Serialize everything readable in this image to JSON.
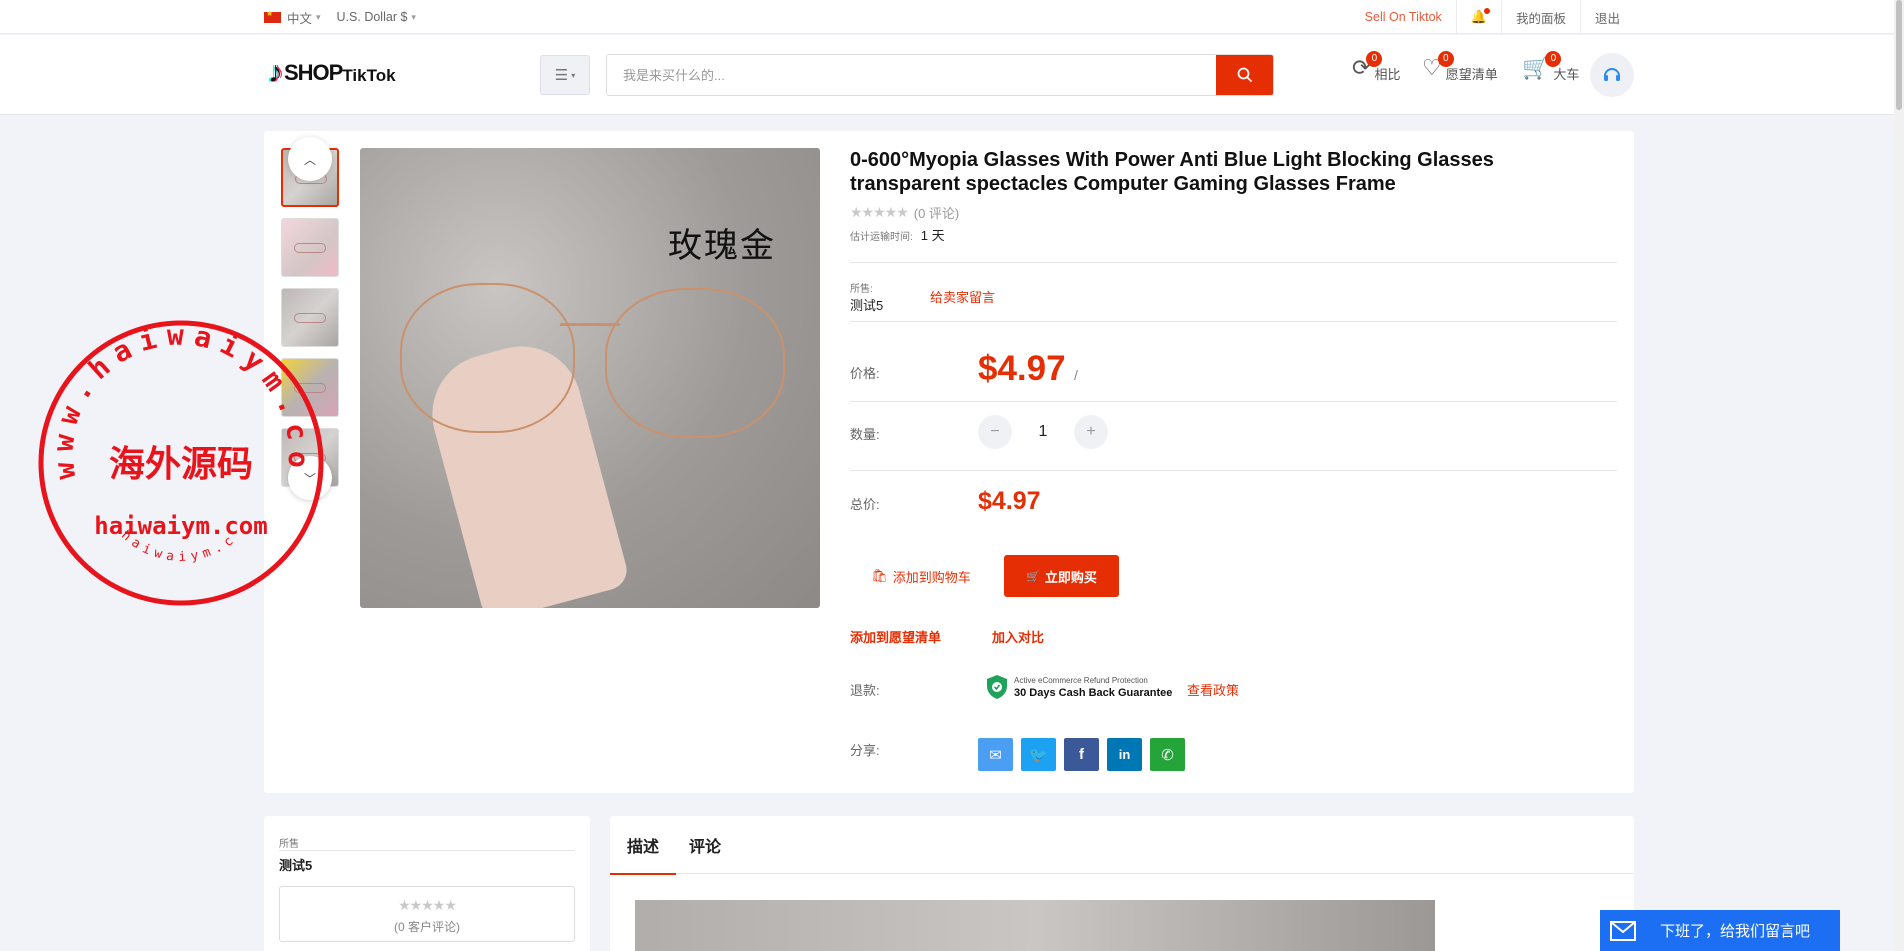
{
  "topbar": {
    "language": "中文",
    "currency": "U.S. Dollar $",
    "sell_link": "Sell On Tiktok",
    "dashboard": "我的面板",
    "logout": "退出"
  },
  "header": {
    "logo_shop": "SHOP",
    "logo_tiktok": "TikTok",
    "search_placeholder": "我是来买什么的...",
    "compare": {
      "label": "相比",
      "count": "0"
    },
    "wishlist": {
      "label": "愿望清单",
      "count": "0"
    },
    "cart": {
      "label": "大车",
      "count": "0"
    }
  },
  "product": {
    "title": "0-600°Myopia Glasses With Power Anti Blue Light Blocking Glasses transparent spectacles Computer Gaming Glasses Frame",
    "review_count": "(0 评论)",
    "rating": 0,
    "eta_label": "估计运输时间:",
    "eta_value": "1 天",
    "sold_by_label": "所售:",
    "seller_name": "测试5",
    "message_seller": "给卖家留言",
    "price_label": "价格:",
    "price": "$4.97",
    "price_unit": "/",
    "quantity_label": "数量:",
    "quantity": "1",
    "total_label": "总价:",
    "total": "$4.97",
    "add_to_cart": "添加到购物车",
    "buy_now": "立即购买",
    "add_wishlist": "添加到愿望清单",
    "add_compare": "加入对比",
    "refund_label": "退款:",
    "refund_small": "Active eCommerce Refund Protection",
    "refund_big": "30 Days Cash Back Guarantee",
    "view_policy": "查看政策",
    "share_label": "分享:",
    "image_text": "玫瑰金"
  },
  "seller_card": {
    "sold_by": "所售",
    "seller_name": "测试5",
    "reviews": "(0 客户评论)"
  },
  "tabs": [
    "描述",
    "评论"
  ],
  "watermark": {
    "outer_text": "www.haiwaiym.com",
    "center_text": "海外源码",
    "domain": "haiwaiym.com",
    "bottom_text": "haiwaiym.com"
  },
  "chat": {
    "label": "下班了，给我们留言吧"
  },
  "colors": {
    "accent": "#e62e04",
    "chat": "#1c6ff2",
    "stamp": "#e8141c"
  }
}
